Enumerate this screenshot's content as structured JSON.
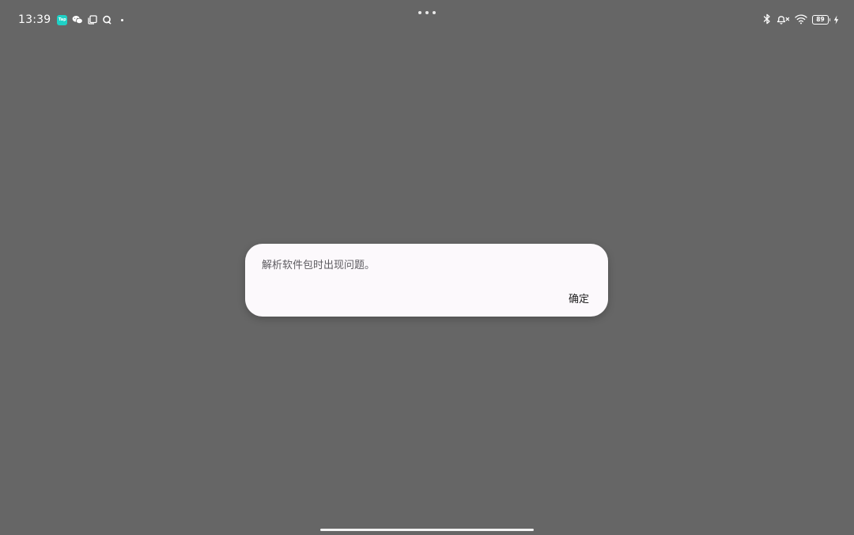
{
  "status_bar": {
    "time": "13:39",
    "left_icons": [
      "taptap-app-icon",
      "wechat-icon",
      "copy-icon",
      "chat-bubble-icon",
      "dot-icon"
    ],
    "right_icons": [
      "bluetooth-icon",
      "bell-muted-icon",
      "wifi-icon",
      "battery-icon",
      "charging-icon"
    ],
    "taptap_label": "Tap",
    "battery_level": "89"
  },
  "dialog": {
    "message": "解析软件包时出现问题。",
    "confirm_label": "确定"
  },
  "colors": {
    "scrim": "#666666",
    "dialog_bg": "#fcf9fc",
    "app_tile": "#1fd1c6"
  }
}
